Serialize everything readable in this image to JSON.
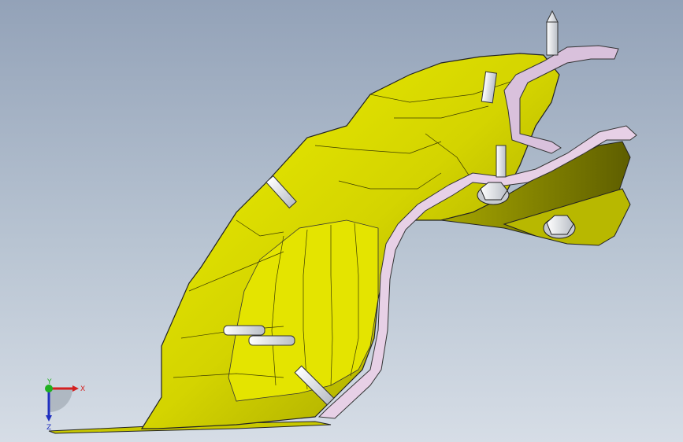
{
  "viewport": {
    "background_top": "#93a2b8",
    "background_bottom": "#d6dde6"
  },
  "model": {
    "part_color": "#d8d800",
    "part_shadow_color": "#9c9c00",
    "bracket_color": "#dcc6e0",
    "bolt_color": "#f2f4f6"
  },
  "triad": {
    "x_label": "X",
    "y_label": "Y",
    "z_label": "Z",
    "x_color": "#d42020",
    "y_color": "#20b020",
    "z_color": "#2030c0"
  }
}
